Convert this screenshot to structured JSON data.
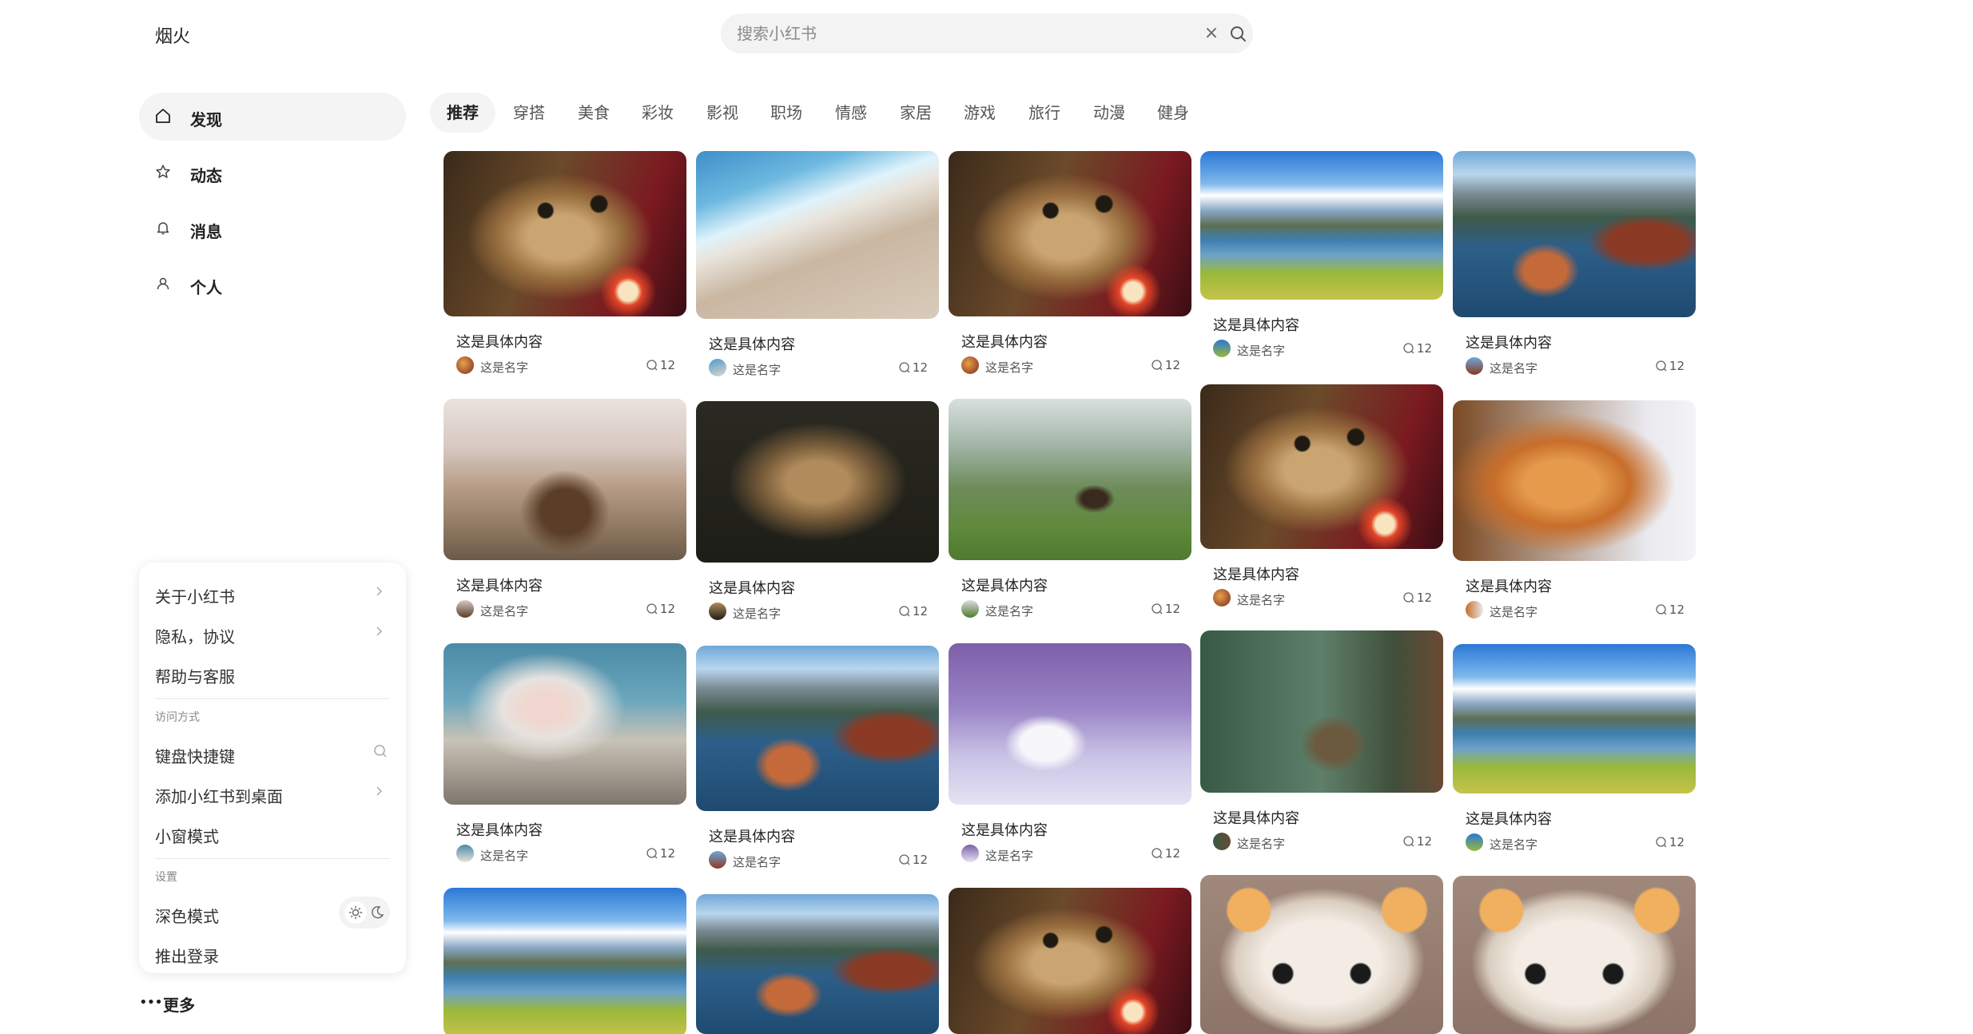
{
  "app": {
    "logo": "烟火"
  },
  "search": {
    "placeholder": "搜索小红书",
    "value": ""
  },
  "nav": {
    "items": [
      {
        "label": "发现",
        "icon": "home-icon",
        "active": true
      },
      {
        "label": "动态",
        "icon": "star-icon",
        "active": false
      },
      {
        "label": "消息",
        "icon": "bell-icon",
        "active": false
      },
      {
        "label": "个人",
        "icon": "user-icon",
        "active": false
      }
    ]
  },
  "menu": {
    "items": [
      {
        "label": "关于小红书",
        "icon": "chevron-right-icon"
      },
      {
        "label": "隐私，协议",
        "icon": "chevron-right-icon"
      },
      {
        "label": "帮助与客服",
        "icon": ""
      }
    ],
    "access_section": "访问方式",
    "access_items": [
      {
        "label": "键盘快捷键",
        "icon": "search-icon"
      },
      {
        "label": "添加小红书到桌面",
        "icon": "chevron-right-icon"
      },
      {
        "label": "小窗模式",
        "icon": ""
      }
    ],
    "settings_section": "设置",
    "settings_items": [
      {
        "label": "深色模式",
        "icon": "theme-toggle"
      },
      {
        "label": "推出登录",
        "icon": ""
      }
    ]
  },
  "more": {
    "dots": "•••",
    "label": "更多"
  },
  "tabs": [
    "推荐",
    "穿搭",
    "美食",
    "彩妆",
    "影视",
    "职场",
    "情感",
    "家居",
    "游戏",
    "旅行",
    "动漫",
    "健身"
  ],
  "active_tab": "推荐",
  "feed": [
    {
      "title": "这是具体内容",
      "author": "这是名字",
      "likes": "12",
      "image": "cat"
    },
    {
      "title": "这是具体内容",
      "author": "这是名字",
      "likes": "12",
      "image": "wave"
    },
    {
      "title": "这是具体内容",
      "author": "这是名字",
      "likes": "12",
      "image": "cat"
    },
    {
      "title": "这是具体内容",
      "author": "这是名字",
      "likes": "12",
      "image": "lake"
    },
    {
      "title": "这是具体内容",
      "author": "这是名字",
      "likes": "12",
      "image": "rocks"
    },
    {
      "title": "这是具体内容",
      "author": "这是名字",
      "likes": "12",
      "image": "deer"
    },
    {
      "title": "这是具体内容",
      "author": "这是名字",
      "likes": "12",
      "image": "lion"
    },
    {
      "title": "这是具体内容",
      "author": "这是名字",
      "likes": "12",
      "image": "horse"
    },
    {
      "title": "这是具体内容",
      "author": "这是名字",
      "likes": "12",
      "image": "cat"
    },
    {
      "title": "这是具体内容",
      "author": "这是名字",
      "likes": "12",
      "image": "fox"
    },
    {
      "title": "这是具体内容",
      "author": "这是名字",
      "likes": "12",
      "image": "monkey"
    },
    {
      "title": "这是具体内容",
      "author": "这是名字",
      "likes": "12",
      "image": "rocks"
    },
    {
      "title": "这是具体内容",
      "author": "这是名字",
      "likes": "12",
      "image": "fox2"
    },
    {
      "title": "这是具体内容",
      "author": "这是名字",
      "likes": "12",
      "image": "forest"
    },
    {
      "title": "这是具体内容",
      "author": "这是名字",
      "likes": "12",
      "image": "lake"
    },
    {
      "title": "",
      "author": "",
      "likes": "",
      "image": "lake"
    },
    {
      "title": "",
      "author": "",
      "likes": "",
      "image": "rocks"
    },
    {
      "title": "",
      "author": "",
      "likes": "",
      "image": "cat"
    },
    {
      "title": "",
      "author": "",
      "likes": "",
      "image": "kitten"
    },
    {
      "title": "",
      "author": "",
      "likes": "",
      "image": "kitten"
    }
  ]
}
